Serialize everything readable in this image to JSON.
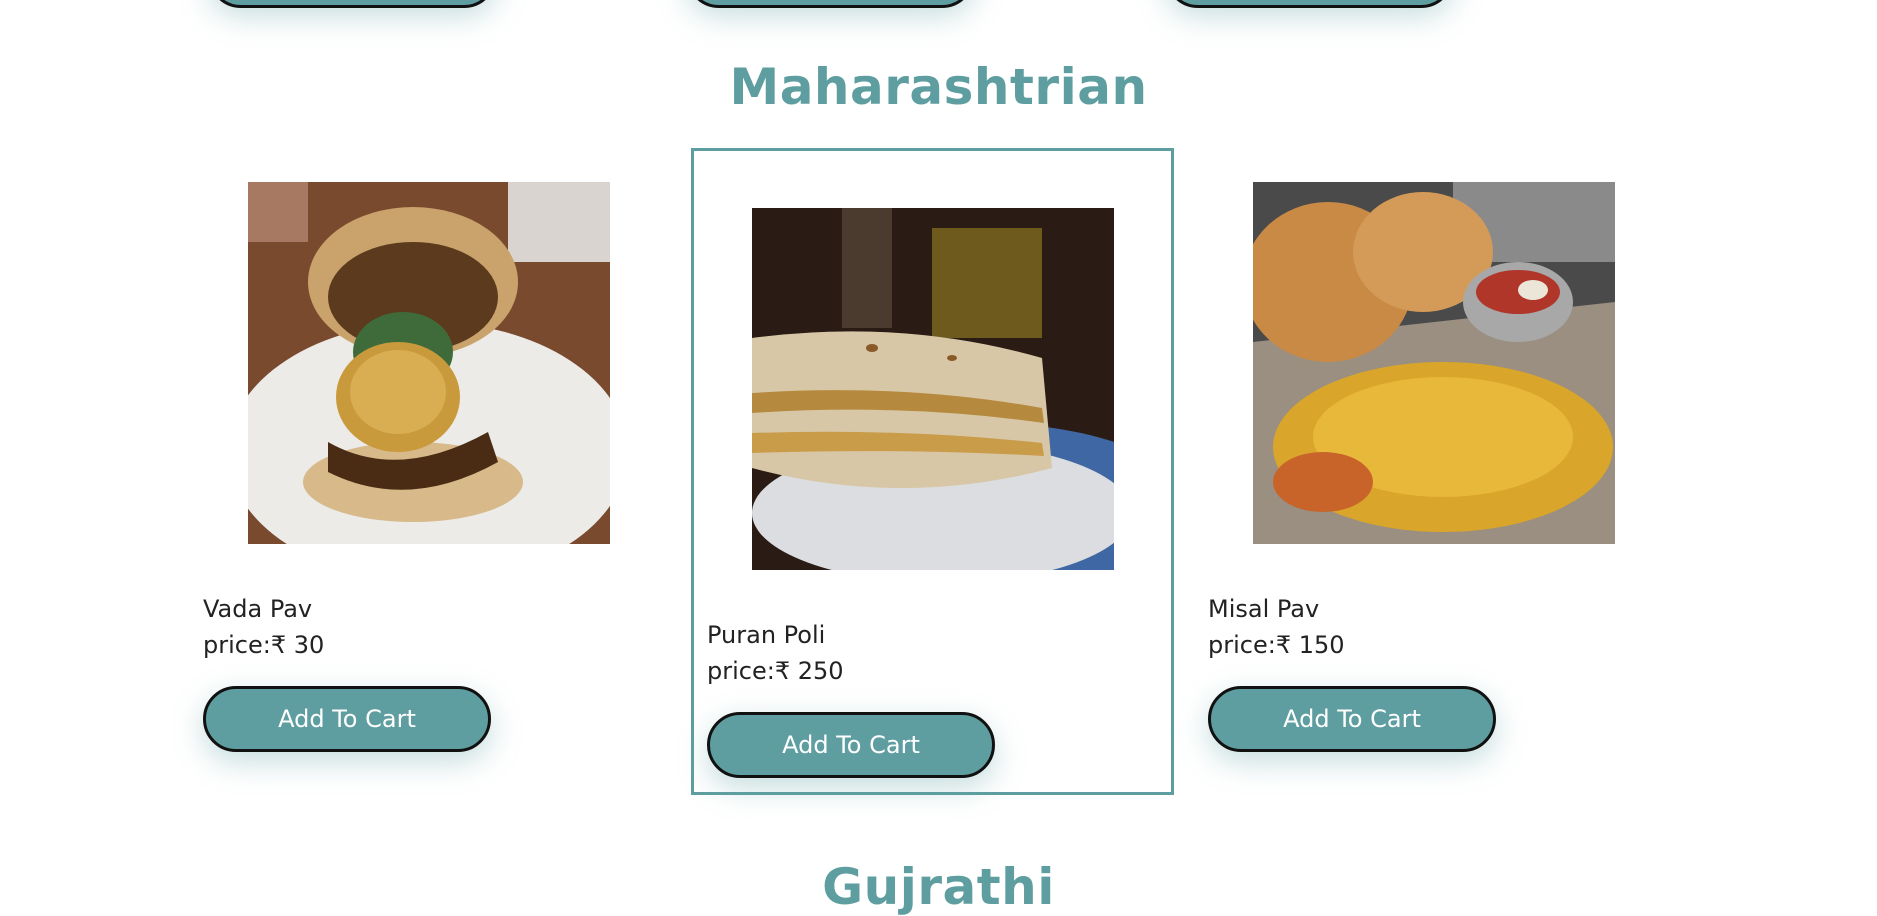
{
  "sections": {
    "maharashtrian": {
      "title": "Maharashtrian",
      "items": [
        {
          "name": "Vada Pav",
          "price": "price:₹ 30",
          "button": "Add To Cart"
        },
        {
          "name": "Puran Poli",
          "price": "price:₹ 250",
          "button": "Add To Cart"
        },
        {
          "name": "Misal Pav",
          "price": "price:₹ 150",
          "button": "Add To Cart"
        }
      ]
    },
    "gujrathi": {
      "title": "Gujrathi"
    }
  },
  "colors": {
    "accent": "#5f9ea0",
    "button_border": "#111111",
    "text": "#222222"
  }
}
